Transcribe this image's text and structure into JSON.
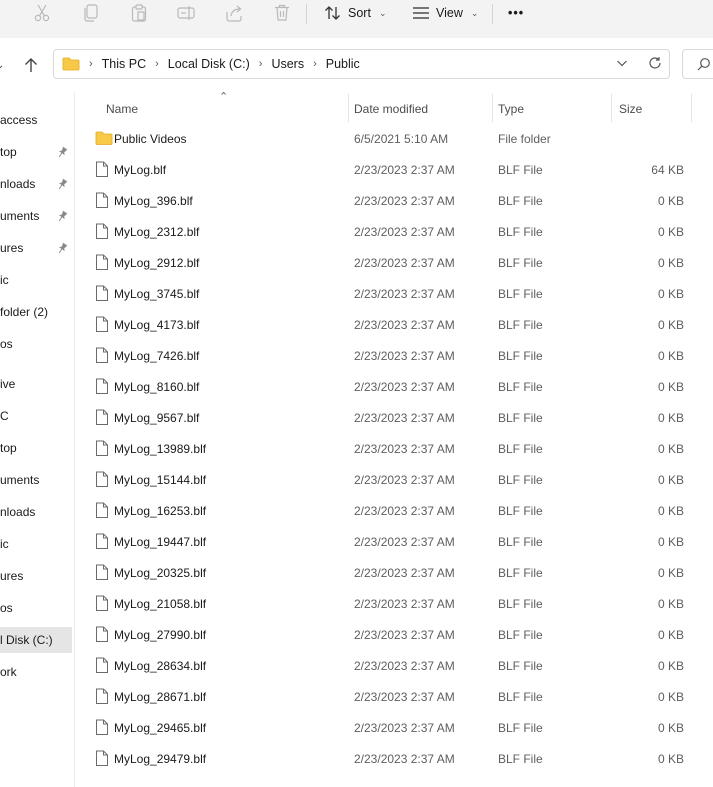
{
  "toolbar": {
    "sort_label": "Sort",
    "view_label": "View",
    "more_label": "•••",
    "icons": [
      "cut-icon",
      "copy-icon",
      "paste-icon",
      "rename-icon",
      "share-icon",
      "delete-icon",
      "sort-icon",
      "view-icon",
      "more-icon"
    ]
  },
  "address": {
    "breadcrumbs": [
      "This PC",
      "Local Disk (C:)",
      "Users",
      "Public"
    ]
  },
  "sidebar": {
    "items": [
      {
        "label": "access",
        "pinned": false
      },
      {
        "label": "top",
        "pinned": true
      },
      {
        "label": "nloads",
        "pinned": true
      },
      {
        "label": "uments",
        "pinned": true
      },
      {
        "label": "ures",
        "pinned": true
      },
      {
        "label": "ic",
        "pinned": false
      },
      {
        "label": "folder (2)",
        "pinned": false
      },
      {
        "label": "os",
        "pinned": false
      },
      {
        "label": "ive",
        "pinned": false
      },
      {
        "label": "C",
        "pinned": false
      },
      {
        "label": "top",
        "pinned": false
      },
      {
        "label": "uments",
        "pinned": false
      },
      {
        "label": "nloads",
        "pinned": false
      },
      {
        "label": "ic",
        "pinned": false
      },
      {
        "label": "ures",
        "pinned": false
      },
      {
        "label": "os",
        "pinned": false
      },
      {
        "label": "l Disk (C:)",
        "pinned": false,
        "selected": true
      },
      {
        "label": "ork",
        "pinned": false
      }
    ]
  },
  "columns": {
    "name": "Name",
    "date": "Date modified",
    "type": "Type",
    "size": "Size"
  },
  "files": [
    {
      "name": "Public Videos",
      "date": "6/5/2021 5:10 AM",
      "type": "File folder",
      "size": "",
      "icon": "folder-icon"
    },
    {
      "name": "MyLog.blf",
      "date": "2/23/2023 2:37 AM",
      "type": "BLF File",
      "size": "64 KB",
      "icon": "file-icon"
    },
    {
      "name": "MyLog_396.blf",
      "date": "2/23/2023 2:37 AM",
      "type": "BLF File",
      "size": "0 KB",
      "icon": "file-icon"
    },
    {
      "name": "MyLog_2312.blf",
      "date": "2/23/2023 2:37 AM",
      "type": "BLF File",
      "size": "0 KB",
      "icon": "file-icon"
    },
    {
      "name": "MyLog_2912.blf",
      "date": "2/23/2023 2:37 AM",
      "type": "BLF File",
      "size": "0 KB",
      "icon": "file-icon"
    },
    {
      "name": "MyLog_3745.blf",
      "date": "2/23/2023 2:37 AM",
      "type": "BLF File",
      "size": "0 KB",
      "icon": "file-icon"
    },
    {
      "name": "MyLog_4173.blf",
      "date": "2/23/2023 2:37 AM",
      "type": "BLF File",
      "size": "0 KB",
      "icon": "file-icon"
    },
    {
      "name": "MyLog_7426.blf",
      "date": "2/23/2023 2:37 AM",
      "type": "BLF File",
      "size": "0 KB",
      "icon": "file-icon"
    },
    {
      "name": "MyLog_8160.blf",
      "date": "2/23/2023 2:37 AM",
      "type": "BLF File",
      "size": "0 KB",
      "icon": "file-icon"
    },
    {
      "name": "MyLog_9567.blf",
      "date": "2/23/2023 2:37 AM",
      "type": "BLF File",
      "size": "0 KB",
      "icon": "file-icon"
    },
    {
      "name": "MyLog_13989.blf",
      "date": "2/23/2023 2:37 AM",
      "type": "BLF File",
      "size": "0 KB",
      "icon": "file-icon"
    },
    {
      "name": "MyLog_15144.blf",
      "date": "2/23/2023 2:37 AM",
      "type": "BLF File",
      "size": "0 KB",
      "icon": "file-icon"
    },
    {
      "name": "MyLog_16253.blf",
      "date": "2/23/2023 2:37 AM",
      "type": "BLF File",
      "size": "0 KB",
      "icon": "file-icon"
    },
    {
      "name": "MyLog_19447.blf",
      "date": "2/23/2023 2:37 AM",
      "type": "BLF File",
      "size": "0 KB",
      "icon": "file-icon"
    },
    {
      "name": "MyLog_20325.blf",
      "date": "2/23/2023 2:37 AM",
      "type": "BLF File",
      "size": "0 KB",
      "icon": "file-icon"
    },
    {
      "name": "MyLog_21058.blf",
      "date": "2/23/2023 2:37 AM",
      "type": "BLF File",
      "size": "0 KB",
      "icon": "file-icon"
    },
    {
      "name": "MyLog_27990.blf",
      "date": "2/23/2023 2:37 AM",
      "type": "BLF File",
      "size": "0 KB",
      "icon": "file-icon"
    },
    {
      "name": "MyLog_28634.blf",
      "date": "2/23/2023 2:37 AM",
      "type": "BLF File",
      "size": "0 KB",
      "icon": "file-icon"
    },
    {
      "name": "MyLog_28671.blf",
      "date": "2/23/2023 2:37 AM",
      "type": "BLF File",
      "size": "0 KB",
      "icon": "file-icon"
    },
    {
      "name": "MyLog_29465.blf",
      "date": "2/23/2023 2:37 AM",
      "type": "BLF File",
      "size": "0 KB",
      "icon": "file-icon"
    },
    {
      "name": "MyLog_29479.blf",
      "date": "2/23/2023 2:37 AM",
      "type": "BLF File",
      "size": "0 KB",
      "icon": "file-icon"
    }
  ],
  "colors": {
    "folder": "#f8c946",
    "selected_bg": "#e5e5e5",
    "toolbar_bg": "#f3f3f3"
  }
}
